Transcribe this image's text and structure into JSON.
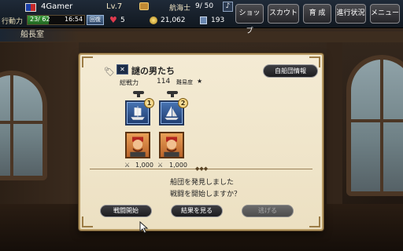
{
  "status": {
    "username": "4Gamer",
    "level": "Lv.7",
    "ap_label": "行動力",
    "ap_value": "23/ 62",
    "ap_fraction": 0.37,
    "ap_timer": "16:54",
    "recover_label": "回復",
    "hearts": "5",
    "sailors_label": "航海士",
    "sailors_value": "9/ 50",
    "coins": "21,062",
    "books": "193"
  },
  "menu": {
    "shop": "ショップ",
    "scout": "スカウト",
    "train": "育 成",
    "progress": "進行状況",
    "menu": "メニュー"
  },
  "location": "船長室",
  "dialog": {
    "fleet_name": "謎の男たち",
    "power_label": "総戦力",
    "power_value": "114",
    "difficulty_label": "難易度",
    "difficulty_stars": "★",
    "own_fleet_button": "自船団情報",
    "units": [
      {
        "rank": "1",
        "troops": "1,000"
      },
      {
        "rank": "2",
        "troops": "1,000"
      }
    ],
    "message_line1": "船団を発見しました",
    "message_line2": "戦闘を開始しますか？",
    "start_battle": "戦闘開始",
    "view_result": "結果を見る",
    "flee": "逃げる"
  },
  "colors": {
    "panel_bg": "#f0e6cc",
    "button_dark": "#2b2b2f",
    "ship_card": "#2f5592",
    "captain_card": "#d1824a"
  },
  "icons": [
    "flag-icon",
    "treasure-chest-icon",
    "heart-icon",
    "coin-icon",
    "book-icon",
    "music-icon",
    "tag-icon",
    "pirate-flag-icon",
    "ship-icon",
    "captain-portrait",
    "sword-icon",
    "pointer-cursor"
  ]
}
